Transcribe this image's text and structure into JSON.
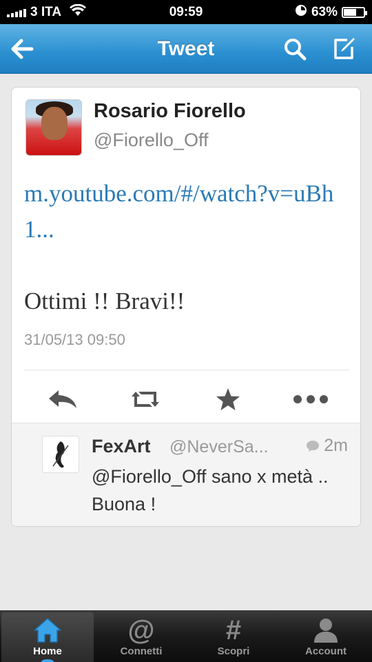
{
  "status_bar": {
    "carrier": "3 ITA",
    "time": "09:59",
    "battery_percent": "63%",
    "battery_level": 0.63
  },
  "nav": {
    "title": "Tweet",
    "back_icon": "back-arrow-icon",
    "search_icon": "search-icon",
    "compose_icon": "compose-icon"
  },
  "tweet": {
    "author_name": "Rosario Fiorello",
    "author_handle": "@Fiorello_Off",
    "link": "m.youtube.com/#/watch?v=uBh1...",
    "body": "Ottimi !! Bravi!!",
    "date": "31/05/13 09:50"
  },
  "actions": [
    "reply-icon",
    "retweet-icon",
    "favorite-star-icon",
    "more-icon"
  ],
  "reply": {
    "author_name": "FexArt",
    "author_handle": "@NeverSa...",
    "time": "2m",
    "text": "@Fiorello_Off sano x metà .. Buona !"
  },
  "tabs": [
    {
      "label": "Home",
      "icon": "home-icon",
      "active": true
    },
    {
      "label": "Connetti",
      "icon": "at-icon",
      "glyph": "@"
    },
    {
      "label": "Scopri",
      "icon": "hashtag-icon",
      "glyph": "#"
    },
    {
      "label": "Account",
      "icon": "person-icon"
    }
  ],
  "colors": {
    "nav_blue": "#2a8fd0",
    "link_blue": "#2a7ab5",
    "tab_active_dot": "#3ba3e8"
  }
}
